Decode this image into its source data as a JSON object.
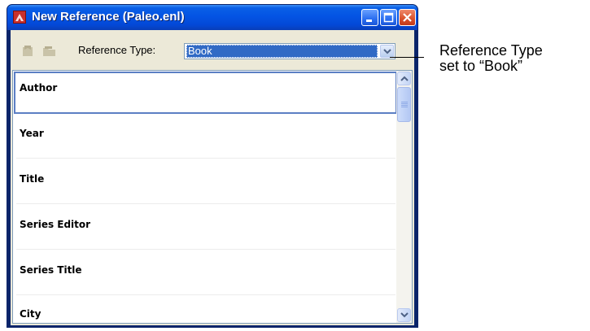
{
  "window": {
    "title": "New Reference (Paleo.enl)",
    "controls": {
      "minimize": "minimize-icon",
      "maximize": "maximize-icon",
      "close": "close-icon"
    }
  },
  "toolbar": {
    "reference_type_label": "Reference Type:",
    "reference_type_value": "Book",
    "icons": [
      "bookmark-icon",
      "folder-icon"
    ]
  },
  "fields": [
    {
      "label": "Author"
    },
    {
      "label": "Year"
    },
    {
      "label": "Title"
    },
    {
      "label": "Series Editor"
    },
    {
      "label": "Series Title"
    },
    {
      "label": "City"
    }
  ],
  "annotation": {
    "line1": "Reference Type",
    "line2": "set to “Book”"
  },
  "colors": {
    "titlebar": "#0454e4",
    "selection": "#316ac5",
    "client_bg": "#ece9d8"
  }
}
